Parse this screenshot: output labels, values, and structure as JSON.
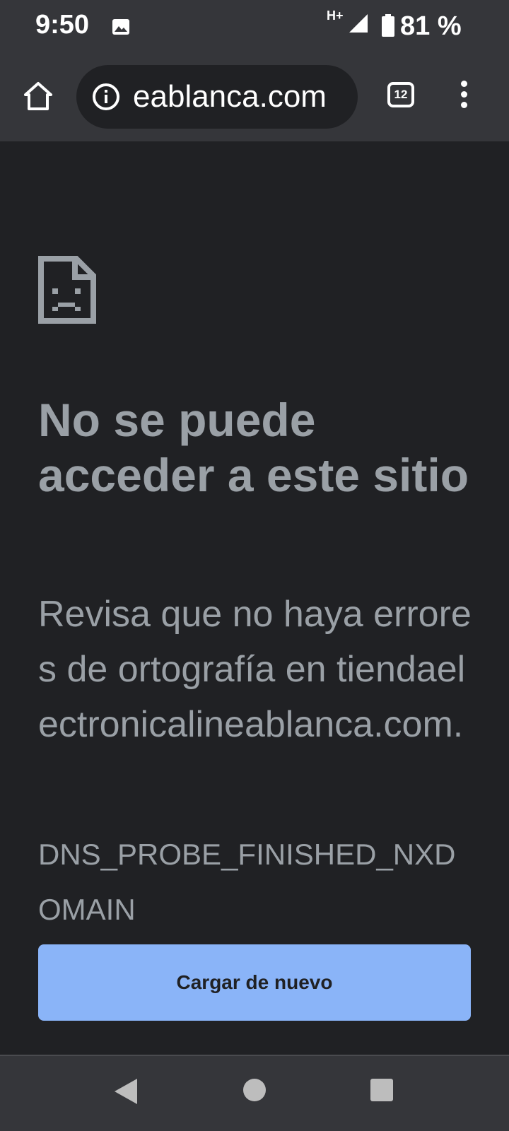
{
  "status_bar": {
    "time": "9:50",
    "network": "H+",
    "battery_percent": "81 %"
  },
  "toolbar": {
    "url": "eablanca.com",
    "tab_count": "12"
  },
  "error": {
    "title": "No se puede acceder a este sitio",
    "description": "Revisa que no haya errores de ortografía en tiendaelectronicalineablanca.com.",
    "code": "DNS_PROBE_FINISHED_NXDOMAIN",
    "reload_label": "Cargar de nuevo"
  },
  "colors": {
    "background": "#202124",
    "toolbar": "#35363a",
    "text_secondary": "#9aa0a6",
    "accent": "#8ab4f8"
  },
  "icons": [
    "image-icon",
    "signal-icon",
    "battery-icon",
    "home-icon",
    "info-icon",
    "tab-switcher-icon",
    "more-vert-icon",
    "sad-page-icon",
    "back-icon",
    "home-circle-icon",
    "recents-icon"
  ]
}
